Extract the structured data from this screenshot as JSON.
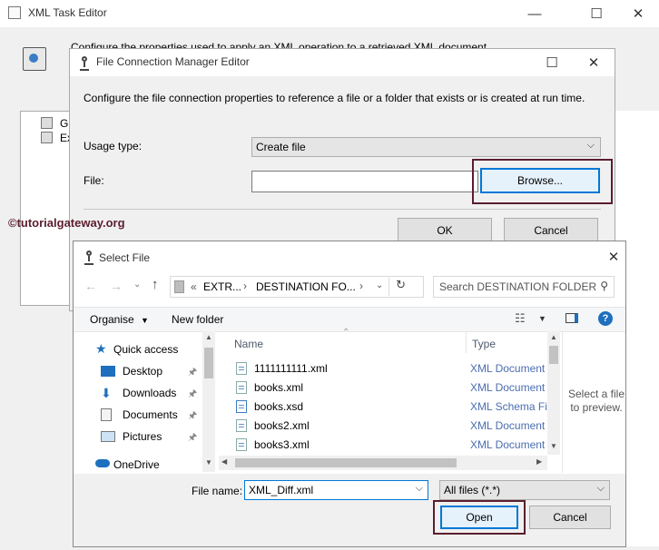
{
  "xml_task_editor": {
    "title": "XML Task Editor",
    "description": "Configure the properties used to apply an XML operation to a retrieved XML document.",
    "tree_items": [
      "G",
      "Ex"
    ]
  },
  "watermark": "©tutorialgateway.org",
  "file_conn_editor": {
    "title": "File Connection Manager Editor",
    "description": "Configure the file connection properties to reference a file or a folder that exists or is created at run time.",
    "usage_type_label": "Usage type:",
    "usage_type_value": "Create file",
    "file_label": "File:",
    "file_value": "",
    "browse_label": "Browse...",
    "ok_label": "OK",
    "cancel_label": "Cancel"
  },
  "select_file": {
    "title": "Select File",
    "breadcrumb": {
      "prefix": "«",
      "segments": [
        "EXTR...",
        "DESTINATION FO..."
      ]
    },
    "search_placeholder": "Search DESTINATION FOLDER",
    "organise_label": "Organise",
    "new_folder_label": "New folder",
    "nav_items": [
      {
        "label": "Quick access",
        "icon": "star-icon",
        "pinned": false
      },
      {
        "label": "Desktop",
        "icon": "desktop-icon",
        "pinned": true
      },
      {
        "label": "Downloads",
        "icon": "download-icon",
        "pinned": true
      },
      {
        "label": "Documents",
        "icon": "documents-icon",
        "pinned": true
      },
      {
        "label": "Pictures",
        "icon": "pictures-icon",
        "pinned": true
      },
      {
        "label": "OneDrive",
        "icon": "cloud-icon",
        "pinned": false
      }
    ],
    "columns": {
      "name": "Name",
      "type": "Type"
    },
    "files": [
      {
        "name": "1111111111.xml",
        "type": "XML Document"
      },
      {
        "name": "books.xml",
        "type": "XML Document"
      },
      {
        "name": "books.xsd",
        "type": "XML Schema Fil"
      },
      {
        "name": "books2.xml",
        "type": "XML Document"
      },
      {
        "name": "books3.xml",
        "type": "XML Document"
      }
    ],
    "preview_text": "Select a file to preview.",
    "filename_label": "File name:",
    "filename_value": "XML_Diff.xml",
    "filter_value": "All files (*.*)",
    "open_label": "Open",
    "cancel_label": "Cancel"
  },
  "colors": {
    "highlight": "#5b1d2e",
    "link_blue": "#4b6eaf",
    "accent": "#0078d7"
  }
}
